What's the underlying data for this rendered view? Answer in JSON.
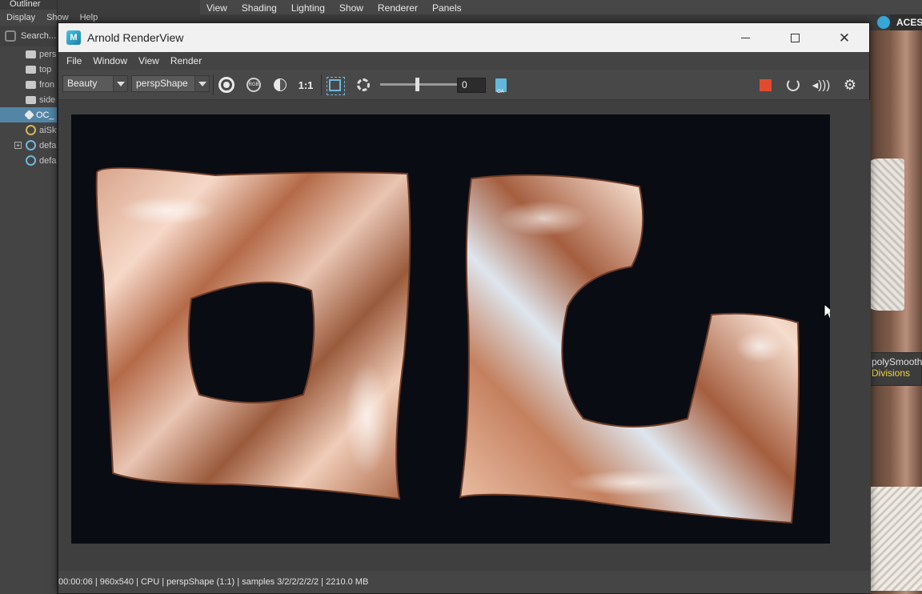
{
  "outliner": {
    "title": "Outliner",
    "menu": [
      "Display",
      "Show",
      "Help"
    ],
    "search_placeholder": "Search...",
    "items": [
      {
        "label": "pers",
        "icon": "camera-icon"
      },
      {
        "label": "top",
        "icon": "camera-icon"
      },
      {
        "label": "fron",
        "icon": "camera-icon"
      },
      {
        "label": "side",
        "icon": "camera-icon"
      },
      {
        "label": "OC_",
        "icon": "mesh-icon",
        "selected": true
      },
      {
        "label": "aiSky",
        "icon": "skydome-icon"
      },
      {
        "label": "defa",
        "icon": "set-icon",
        "expandable": true
      },
      {
        "label": "defa",
        "icon": "set-icon"
      }
    ]
  },
  "viewport": {
    "menu": [
      "View",
      "Shading",
      "Lighting",
      "Show",
      "Renderer",
      "Panels"
    ],
    "color_space": "ACES"
  },
  "attribute_panel": {
    "node_name": "polySmooth",
    "attribute": "Divisions"
  },
  "render_view": {
    "window_title": "Arnold RenderView",
    "menu": [
      "File",
      "Window",
      "View",
      "Render"
    ],
    "aov": "Beauty",
    "camera": "perspShape",
    "ratio_label": "1:1",
    "exposure_value": "0",
    "exposure_level": 0.5,
    "status_text": "00:00:06 | 960x540 | CPU | perspShape (1:1) | samples 3/2/2/2/2/2 | 2210.0 MB",
    "accent": "#e04b2f"
  }
}
